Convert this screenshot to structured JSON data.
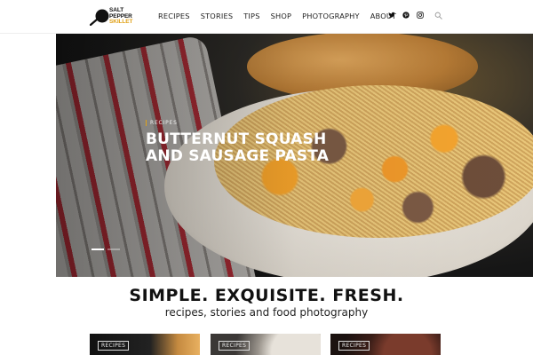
{
  "logo": {
    "line1": "SALT",
    "line2": "PEPPER",
    "line3": "SKILLET",
    "icon": "skillet-icon"
  },
  "nav": {
    "items": [
      {
        "label": "RECIPES"
      },
      {
        "label": "STORIES"
      },
      {
        "label": "TIPS"
      },
      {
        "label": "SHOP"
      },
      {
        "label": "PHOTOGRAPHY"
      },
      {
        "label": "ABOUT"
      }
    ]
  },
  "social": {
    "icons": [
      "twitter-icon",
      "pinterest-icon",
      "instagram-icon"
    ],
    "search_icon": "search-icon"
  },
  "hero": {
    "category": "RECIPES",
    "title": "BUTTERNUT SQUASH AND SAUSAGE PASTA",
    "slides": 2,
    "active_slide": 1
  },
  "tagline": {
    "title": "SIMPLE. EXQUISITE. FRESH.",
    "subtitle": "recipes, stories and food photography"
  },
  "cards": [
    {
      "tag": "RECIPES"
    },
    {
      "tag": "RECIPES"
    },
    {
      "tag": "RECIPES"
    }
  ],
  "colors": {
    "accent": "#e0a21b",
    "text": "#111111",
    "background": "#ffffff"
  }
}
